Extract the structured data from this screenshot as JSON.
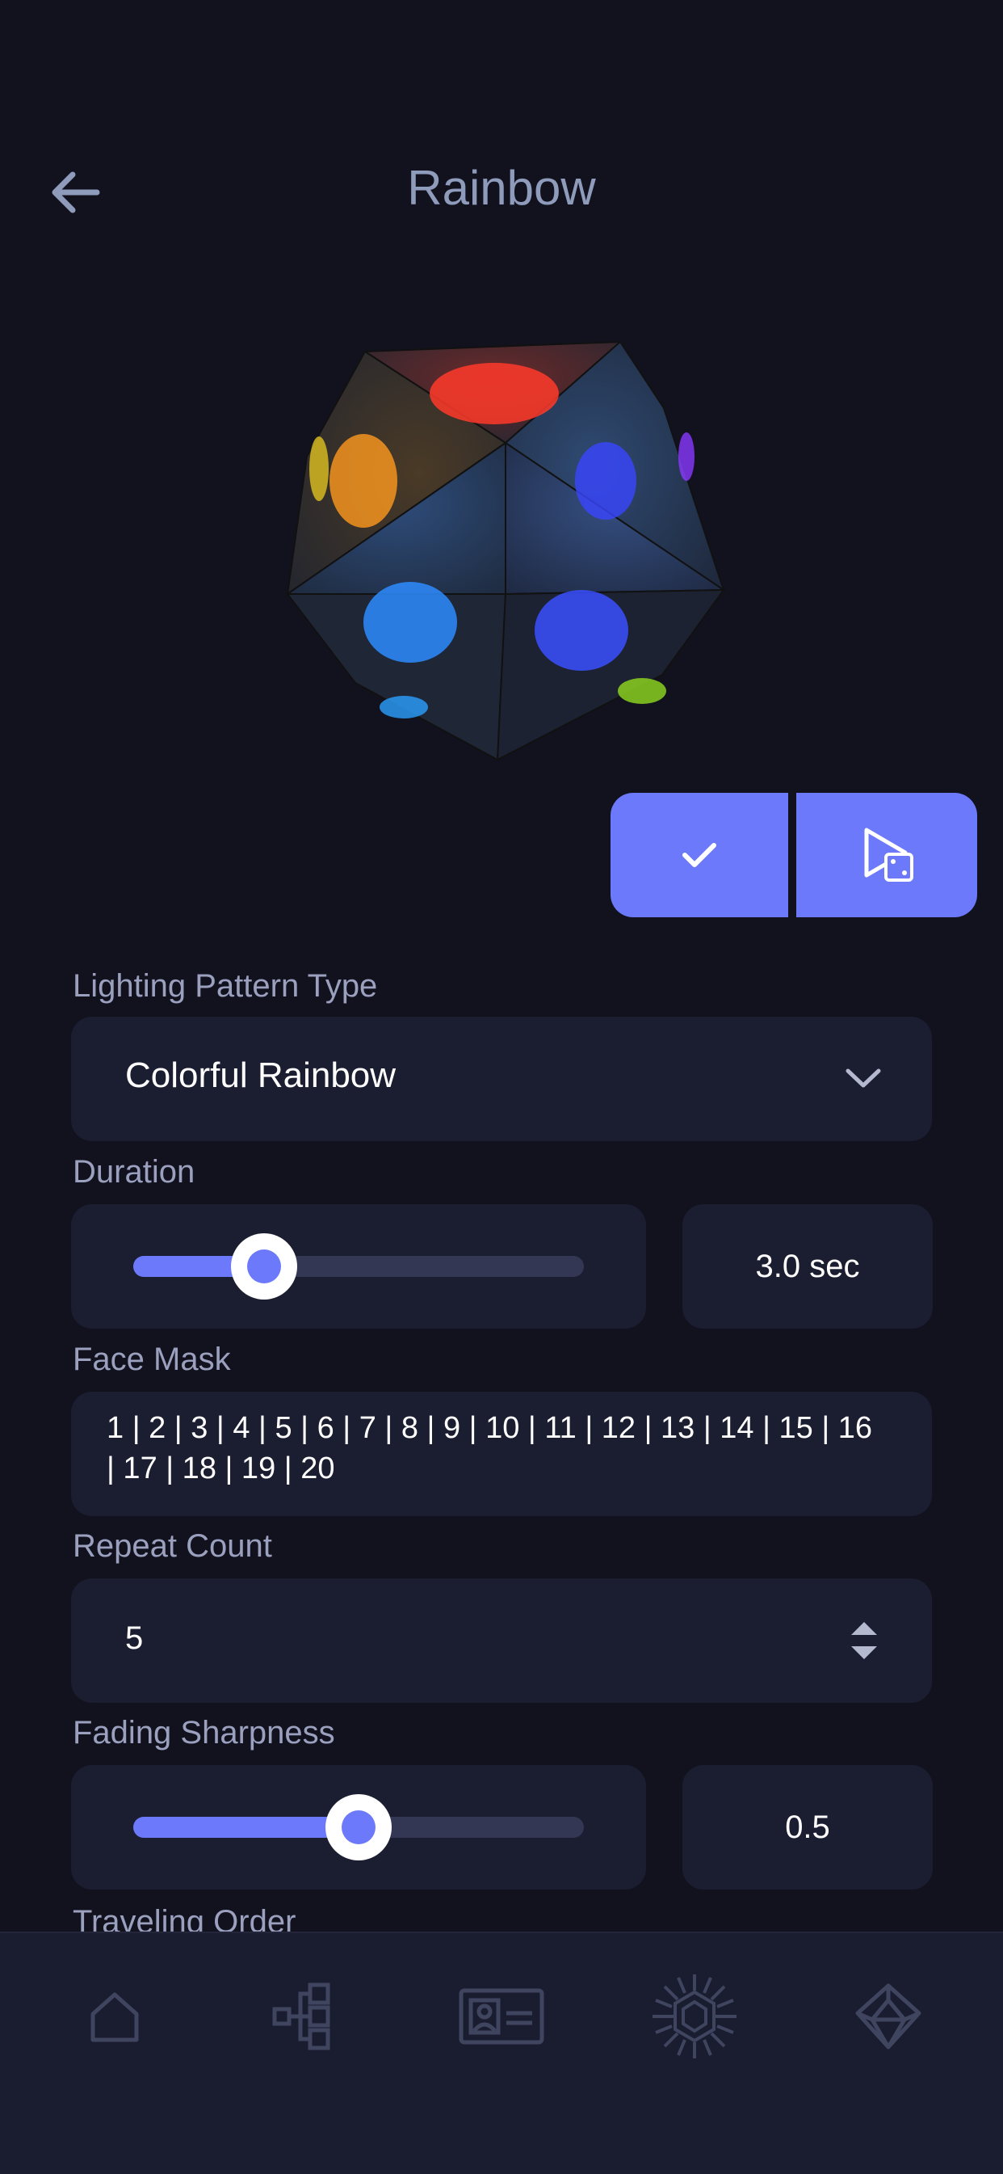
{
  "header": {
    "title": "Rainbow",
    "back_icon": "arrow-left-icon"
  },
  "die": {
    "icon": "d20-die-image"
  },
  "actions": {
    "confirm_icon": "checkmark-icon",
    "preview_icon": "play-preview-icon"
  },
  "form": {
    "lighting_pattern": {
      "label": "Lighting Pattern Type",
      "value": "Colorful Rainbow"
    },
    "duration": {
      "label": "Duration",
      "value_text": "3.0 sec",
      "slider_fraction": 0.29
    },
    "face_mask": {
      "label": "Face Mask",
      "value": "1 | 2 | 3 | 4 | 5 | 6 | 7 | 8 | 9 | 10 | 11 | 12 | 13 | 14 | 15 | 16 | 17 | 18 | 19 | 20"
    },
    "repeat_count": {
      "label": "Repeat Count",
      "value": "5"
    },
    "fading_sharpness": {
      "label": "Fading Sharpness",
      "value_text": "0.5",
      "slider_fraction": 0.5
    },
    "traveling_order": {
      "label": "Traveling Order"
    }
  },
  "tabbar": {
    "items": [
      {
        "icon": "home-icon"
      },
      {
        "icon": "hierarchy-icon"
      },
      {
        "icon": "id-card-icon"
      },
      {
        "icon": "sun-gear-icon"
      },
      {
        "icon": "d20-icon"
      }
    ]
  },
  "colors": {
    "accent": "#6c79fa",
    "background": "#12121f",
    "field": "#1b1d31",
    "muted_text": "#9aa0bd"
  }
}
